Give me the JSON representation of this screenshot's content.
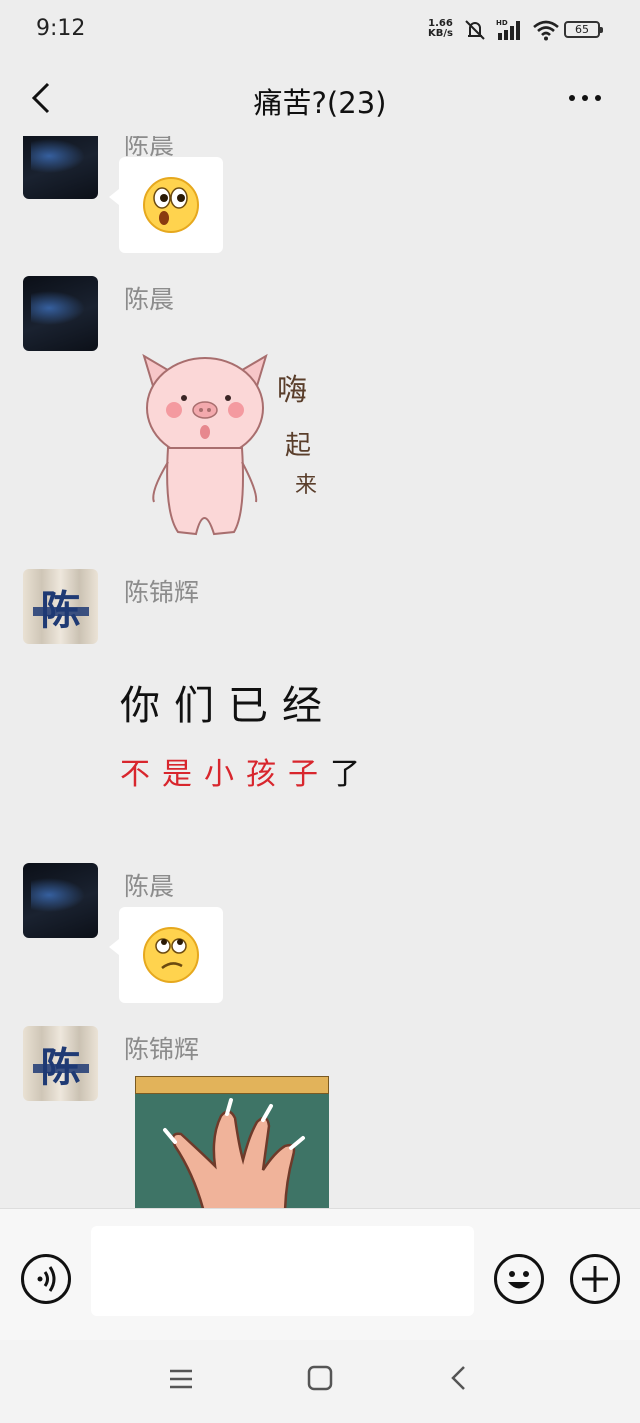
{
  "status_bar": {
    "time": "9:12",
    "net_rate": "1.66",
    "net_unit": "KB/s",
    "battery": "65",
    "icons": [
      "mute-icon",
      "hd-signal-icon",
      "wifi-icon",
      "battery-icon"
    ]
  },
  "header": {
    "title": "痛苦?(23)",
    "back_icon": "chevron-left-icon",
    "more_icon": "more-dots-icon"
  },
  "messages": [
    {
      "sender": "陈晨",
      "type": "emoji",
      "content": "surprised-emoji"
    },
    {
      "sender": "陈晨",
      "type": "sticker",
      "content": "pig-sticker",
      "sticker_text": [
        "嗨",
        "起",
        "来"
      ]
    },
    {
      "sender": "陈锦辉",
      "type": "sticker",
      "content": "text-sticker",
      "line1": "你们已经",
      "line2_red": "不是小孩子",
      "line2_black": "了"
    },
    {
      "sender": "陈晨",
      "type": "emoji",
      "content": "thinking-emoji"
    },
    {
      "sender": "陈锦辉",
      "type": "sticker",
      "content": "claw-hand-sticker"
    }
  ],
  "avatars": {
    "chen_jinhui_glyph": "陈"
  },
  "input_bar": {
    "voice_icon": "voice-icon",
    "text_value": "",
    "emoji_icon": "emoji-icon",
    "plus_icon": "plus-icon"
  },
  "system_nav": [
    "menu-icon",
    "home-icon",
    "back-icon"
  ],
  "colors": {
    "background": "#ededed",
    "bubble": "#ffffff",
    "sender_name": "#8c8c8c",
    "sticker_red": "#d8262d"
  }
}
